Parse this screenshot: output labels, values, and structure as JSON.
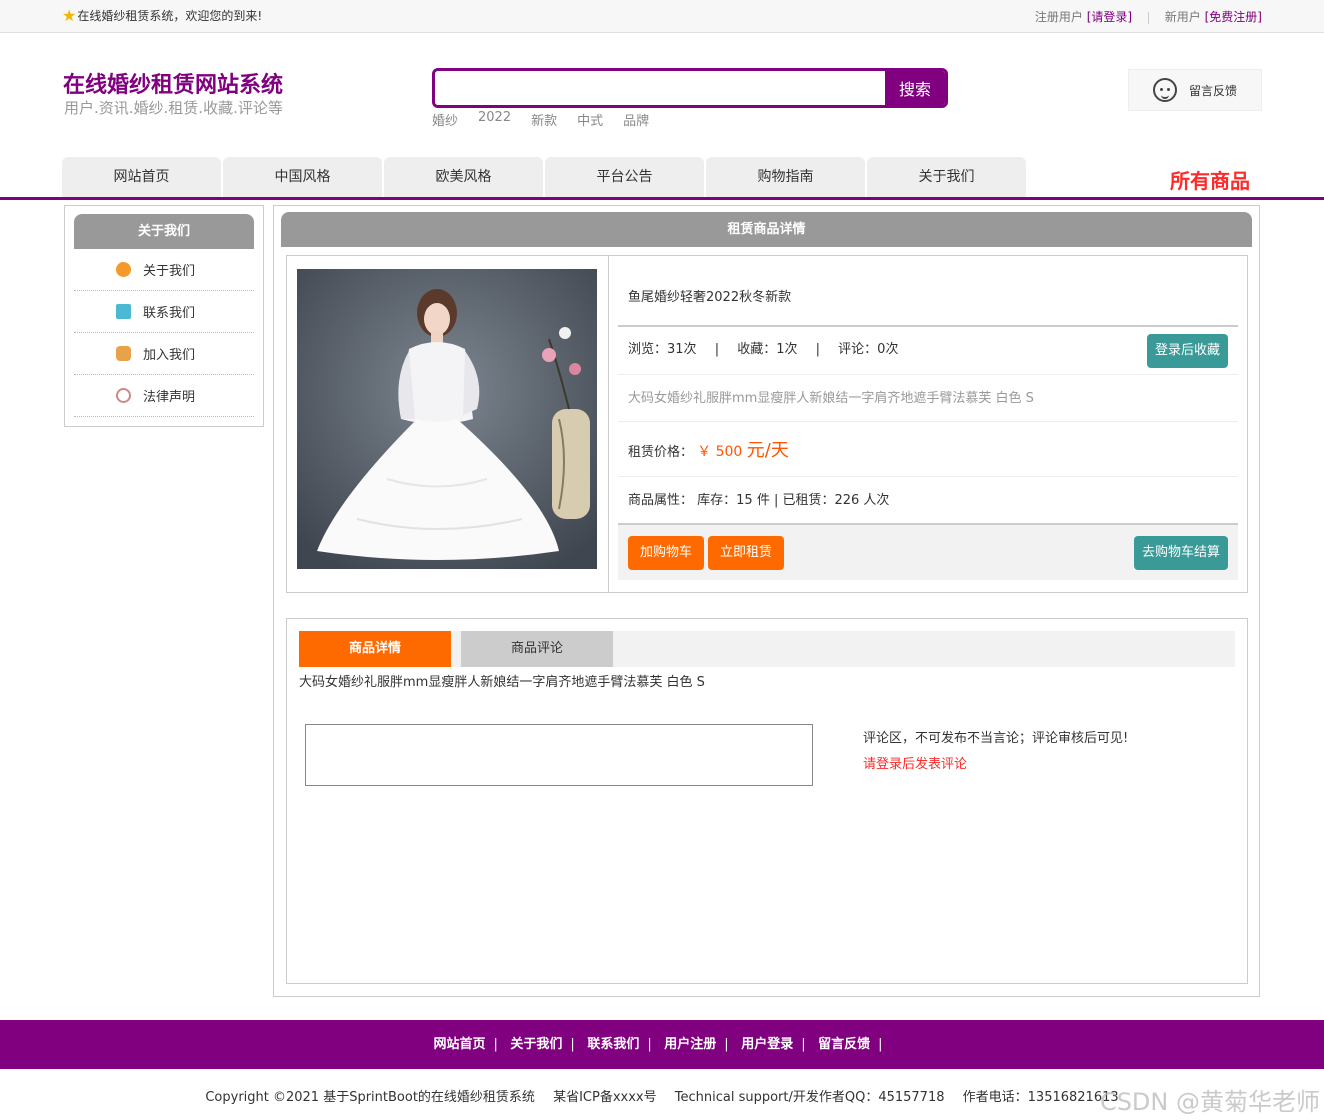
{
  "topbar": {
    "welcome": "在线婚纱租赁系统，欢迎您的到来!",
    "reg_user_label": "注册用户",
    "login_link": "[请登录]",
    "new_user_label": "新用户",
    "register_link": "[免费注册]"
  },
  "header": {
    "title": "在线婚纱租赁网站系统",
    "subtitle": "用户.资讯.婚纱.租赁.收藏.评论等",
    "search_button": "搜索",
    "search_value": "",
    "hot_words": [
      "婚纱",
      "2022",
      "新款",
      "中式",
      "品牌"
    ],
    "feedback": "留言反馈"
  },
  "nav": {
    "items": [
      "网站首页",
      "中国风格",
      "欧美风格",
      "平台公告",
      "购物指南",
      "关于我们"
    ],
    "all_products": "所有商品"
  },
  "sidebar": {
    "title": "关于我们",
    "items": [
      {
        "label": "关于我们",
        "icon": "info-icon",
        "color": "#f39a2b"
      },
      {
        "label": "联系我们",
        "icon": "clipboard-icon",
        "color": "#4bb8d4"
      },
      {
        "label": "加入我们",
        "icon": "lock-icon",
        "color": "#e8a34a"
      },
      {
        "label": "法律声明",
        "icon": "power-icon",
        "color": "#c98a8a"
      }
    ]
  },
  "product": {
    "section_title": "租赁商品详情",
    "name": "鱼尾婚纱轻奢2022秋冬新款",
    "views": "浏览：31次",
    "favorites": "收藏：1次",
    "comments": "评论：0次",
    "stat_sep": "|",
    "collect_button": "登录后收藏",
    "description": "大码女婚纱礼服胖mm显瘦胖人新娘结一字肩齐地遮手臂法慕芙 白色 S",
    "price_label": "租赁价格：",
    "price_symbol": "￥",
    "price_value": "500",
    "price_unit": "元/天",
    "attr_label": "商品属性：",
    "attr_value": "库存：15 件 | 已租赁：226 人次",
    "add_cart_button": "加购物车",
    "rent_now_button": "立即租赁",
    "checkout_button": "去购物车结算"
  },
  "tabs": {
    "detail_tab": "商品详情",
    "comment_tab": "商品评论",
    "detail_text": "大码女婚纱礼服胖mm显瘦胖人新娘结一字肩齐地遮手臂法慕芙 白色 S",
    "comment_note": "评论区，不可发布不当言论；评论审核后可见!",
    "comment_login": "请登录后发表评论"
  },
  "footer": {
    "links": [
      "网站首页",
      "关于我们",
      "联系我们",
      "用户注册",
      "用户登录",
      "留言反馈"
    ],
    "link_sep": "|",
    "copyright": "Copyright ©2021 基于SprintBoot的在线婚纱租赁系统",
    "icp": "某省ICP备xxxx号",
    "support": "Technical support/开发作者QQ：45157718",
    "phone": "作者电话：13516821613",
    "watermark": "CSDN @黄菊华老师"
  },
  "colors": {
    "brand": "#800080",
    "accent": "#ff6a00",
    "green": "#3a9a98",
    "red": "#ff2a2a"
  }
}
